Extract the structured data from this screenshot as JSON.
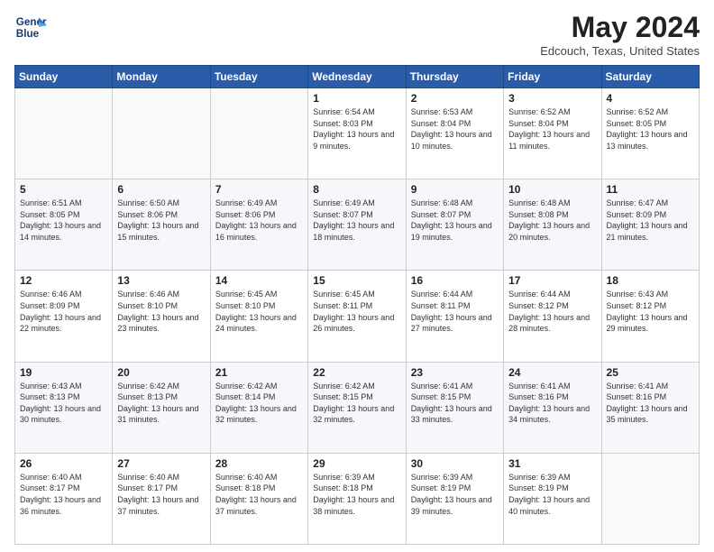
{
  "header": {
    "logo_line1": "General",
    "logo_line2": "Blue",
    "month_year": "May 2024",
    "location": "Edcouch, Texas, United States"
  },
  "weekdays": [
    "Sunday",
    "Monday",
    "Tuesday",
    "Wednesday",
    "Thursday",
    "Friday",
    "Saturday"
  ],
  "weeks": [
    [
      {
        "day": "",
        "info": ""
      },
      {
        "day": "",
        "info": ""
      },
      {
        "day": "",
        "info": ""
      },
      {
        "day": "1",
        "info": "Sunrise: 6:54 AM\nSunset: 8:03 PM\nDaylight: 13 hours and 9 minutes."
      },
      {
        "day": "2",
        "info": "Sunrise: 6:53 AM\nSunset: 8:04 PM\nDaylight: 13 hours and 10 minutes."
      },
      {
        "day": "3",
        "info": "Sunrise: 6:52 AM\nSunset: 8:04 PM\nDaylight: 13 hours and 11 minutes."
      },
      {
        "day": "4",
        "info": "Sunrise: 6:52 AM\nSunset: 8:05 PM\nDaylight: 13 hours and 13 minutes."
      }
    ],
    [
      {
        "day": "5",
        "info": "Sunrise: 6:51 AM\nSunset: 8:05 PM\nDaylight: 13 hours and 14 minutes."
      },
      {
        "day": "6",
        "info": "Sunrise: 6:50 AM\nSunset: 8:06 PM\nDaylight: 13 hours and 15 minutes."
      },
      {
        "day": "7",
        "info": "Sunrise: 6:49 AM\nSunset: 8:06 PM\nDaylight: 13 hours and 16 minutes."
      },
      {
        "day": "8",
        "info": "Sunrise: 6:49 AM\nSunset: 8:07 PM\nDaylight: 13 hours and 18 minutes."
      },
      {
        "day": "9",
        "info": "Sunrise: 6:48 AM\nSunset: 8:07 PM\nDaylight: 13 hours and 19 minutes."
      },
      {
        "day": "10",
        "info": "Sunrise: 6:48 AM\nSunset: 8:08 PM\nDaylight: 13 hours and 20 minutes."
      },
      {
        "day": "11",
        "info": "Sunrise: 6:47 AM\nSunset: 8:09 PM\nDaylight: 13 hours and 21 minutes."
      }
    ],
    [
      {
        "day": "12",
        "info": "Sunrise: 6:46 AM\nSunset: 8:09 PM\nDaylight: 13 hours and 22 minutes."
      },
      {
        "day": "13",
        "info": "Sunrise: 6:46 AM\nSunset: 8:10 PM\nDaylight: 13 hours and 23 minutes."
      },
      {
        "day": "14",
        "info": "Sunrise: 6:45 AM\nSunset: 8:10 PM\nDaylight: 13 hours and 24 minutes."
      },
      {
        "day": "15",
        "info": "Sunrise: 6:45 AM\nSunset: 8:11 PM\nDaylight: 13 hours and 26 minutes."
      },
      {
        "day": "16",
        "info": "Sunrise: 6:44 AM\nSunset: 8:11 PM\nDaylight: 13 hours and 27 minutes."
      },
      {
        "day": "17",
        "info": "Sunrise: 6:44 AM\nSunset: 8:12 PM\nDaylight: 13 hours and 28 minutes."
      },
      {
        "day": "18",
        "info": "Sunrise: 6:43 AM\nSunset: 8:12 PM\nDaylight: 13 hours and 29 minutes."
      }
    ],
    [
      {
        "day": "19",
        "info": "Sunrise: 6:43 AM\nSunset: 8:13 PM\nDaylight: 13 hours and 30 minutes."
      },
      {
        "day": "20",
        "info": "Sunrise: 6:42 AM\nSunset: 8:13 PM\nDaylight: 13 hours and 31 minutes."
      },
      {
        "day": "21",
        "info": "Sunrise: 6:42 AM\nSunset: 8:14 PM\nDaylight: 13 hours and 32 minutes."
      },
      {
        "day": "22",
        "info": "Sunrise: 6:42 AM\nSunset: 8:15 PM\nDaylight: 13 hours and 32 minutes."
      },
      {
        "day": "23",
        "info": "Sunrise: 6:41 AM\nSunset: 8:15 PM\nDaylight: 13 hours and 33 minutes."
      },
      {
        "day": "24",
        "info": "Sunrise: 6:41 AM\nSunset: 8:16 PM\nDaylight: 13 hours and 34 minutes."
      },
      {
        "day": "25",
        "info": "Sunrise: 6:41 AM\nSunset: 8:16 PM\nDaylight: 13 hours and 35 minutes."
      }
    ],
    [
      {
        "day": "26",
        "info": "Sunrise: 6:40 AM\nSunset: 8:17 PM\nDaylight: 13 hours and 36 minutes."
      },
      {
        "day": "27",
        "info": "Sunrise: 6:40 AM\nSunset: 8:17 PM\nDaylight: 13 hours and 37 minutes."
      },
      {
        "day": "28",
        "info": "Sunrise: 6:40 AM\nSunset: 8:18 PM\nDaylight: 13 hours and 37 minutes."
      },
      {
        "day": "29",
        "info": "Sunrise: 6:39 AM\nSunset: 8:18 PM\nDaylight: 13 hours and 38 minutes."
      },
      {
        "day": "30",
        "info": "Sunrise: 6:39 AM\nSunset: 8:19 PM\nDaylight: 13 hours and 39 minutes."
      },
      {
        "day": "31",
        "info": "Sunrise: 6:39 AM\nSunset: 8:19 PM\nDaylight: 13 hours and 40 minutes."
      },
      {
        "day": "",
        "info": ""
      }
    ]
  ]
}
